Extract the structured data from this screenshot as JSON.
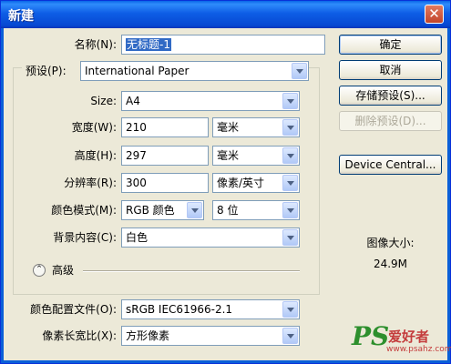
{
  "window": {
    "title": "新建"
  },
  "titlebar": {
    "close_glyph": "✕"
  },
  "form": {
    "name": {
      "label": "名称(N):",
      "value": "无标题-1"
    },
    "preset": {
      "label": "预设(P):",
      "value": "International Paper"
    },
    "size": {
      "label": "Size:",
      "value": "A4"
    },
    "width": {
      "label": "宽度(W):",
      "value": "210",
      "unit": "毫米"
    },
    "height": {
      "label": "高度(H):",
      "value": "297",
      "unit": "毫米"
    },
    "resolution": {
      "label": "分辨率(R):",
      "value": "300",
      "unit": "像素/英寸"
    },
    "color_mode": {
      "label": "颜色模式(M):",
      "value": "RGB 颜色",
      "depth": "8 位"
    },
    "background": {
      "label": "背景内容(C):",
      "value": "白色"
    },
    "advanced": {
      "label": "高级",
      "toggle_glyph": "⌃"
    },
    "color_profile": {
      "label": "颜色配置文件(O):",
      "value": "sRGB IEC61966-2.1"
    },
    "pixel_aspect": {
      "label": "像素长宽比(X):",
      "value": "方形像素"
    }
  },
  "buttons": {
    "ok": "确定",
    "cancel": "取消",
    "save_preset": "存储预设(S)...",
    "delete_preset": "删除预设(D)...",
    "device_central": "Device Central..."
  },
  "image_size": {
    "label": "图像大小:",
    "value": "24.9M"
  },
  "watermark": {
    "ps": "PS",
    "cn": "爱好者",
    "url": "www.psahz.com"
  },
  "colors": {
    "titlebar": "#0a5fd8",
    "highlight": "#316ac5",
    "dialog_bg": "#ece9d8"
  }
}
